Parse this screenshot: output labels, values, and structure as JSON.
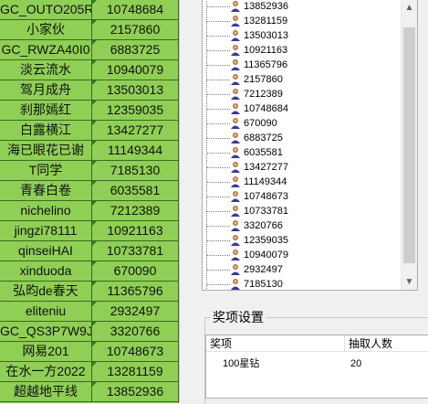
{
  "rows": [
    {
      "name": "GC_OUTO205R",
      "id": "10748684"
    },
    {
      "name": "小家伙",
      "id": "2157860"
    },
    {
      "name": "GC_RWZA40I0",
      "id": "6883725"
    },
    {
      "name": "淡云流水",
      "id": "10940079"
    },
    {
      "name": "驾月成舟",
      "id": "13503013"
    },
    {
      "name": "刹那嫣红",
      "id": "12359035"
    },
    {
      "name": "白露横江",
      "id": "13427277"
    },
    {
      "name": "海已眼花已谢",
      "id": "11149344"
    },
    {
      "name": "T同学",
      "id": "7185130"
    },
    {
      "name": "青春白卷",
      "id": "6035581"
    },
    {
      "name": "nichelino",
      "id": "7212389"
    },
    {
      "name": "jingzi78111",
      "id": "10921163"
    },
    {
      "name": "qinseiHAI",
      "id": "10733781"
    },
    {
      "name": "xinduoda",
      "id": "670090"
    },
    {
      "name": "弘昀de春天",
      "id": "11365796"
    },
    {
      "name": "eliteniu",
      "id": "2932497"
    },
    {
      "name": "GC_QS3P7W9J",
      "id": "3320766"
    },
    {
      "name": "网易201",
      "id": "10748673"
    },
    {
      "name": "在水一方2022",
      "id": "13281159"
    },
    {
      "name": "超越地平线",
      "id": "13852936"
    }
  ],
  "tree_items": [
    "13852936",
    "13281159",
    "13503013",
    "10921163",
    "11365796",
    "2157860",
    "7212389",
    "10748684",
    "670090",
    "6883725",
    "6035581",
    "13427277",
    "11149344",
    "10748673",
    "10733781",
    "3320766",
    "12359035",
    "10940079",
    "2932497",
    "7185130"
  ],
  "prize_group": {
    "title": "奖项设置",
    "col_prize": "奖项",
    "col_count": "抽取人数",
    "rows": [
      {
        "prize": "100星钻",
        "count": "20"
      }
    ]
  },
  "scroll": {
    "up": "▲",
    "down": "▼"
  },
  "colors": {
    "sheet_bg": "#8fcf55",
    "grid": "#3c6a1e",
    "panel_bg": "#f0f0f0"
  }
}
